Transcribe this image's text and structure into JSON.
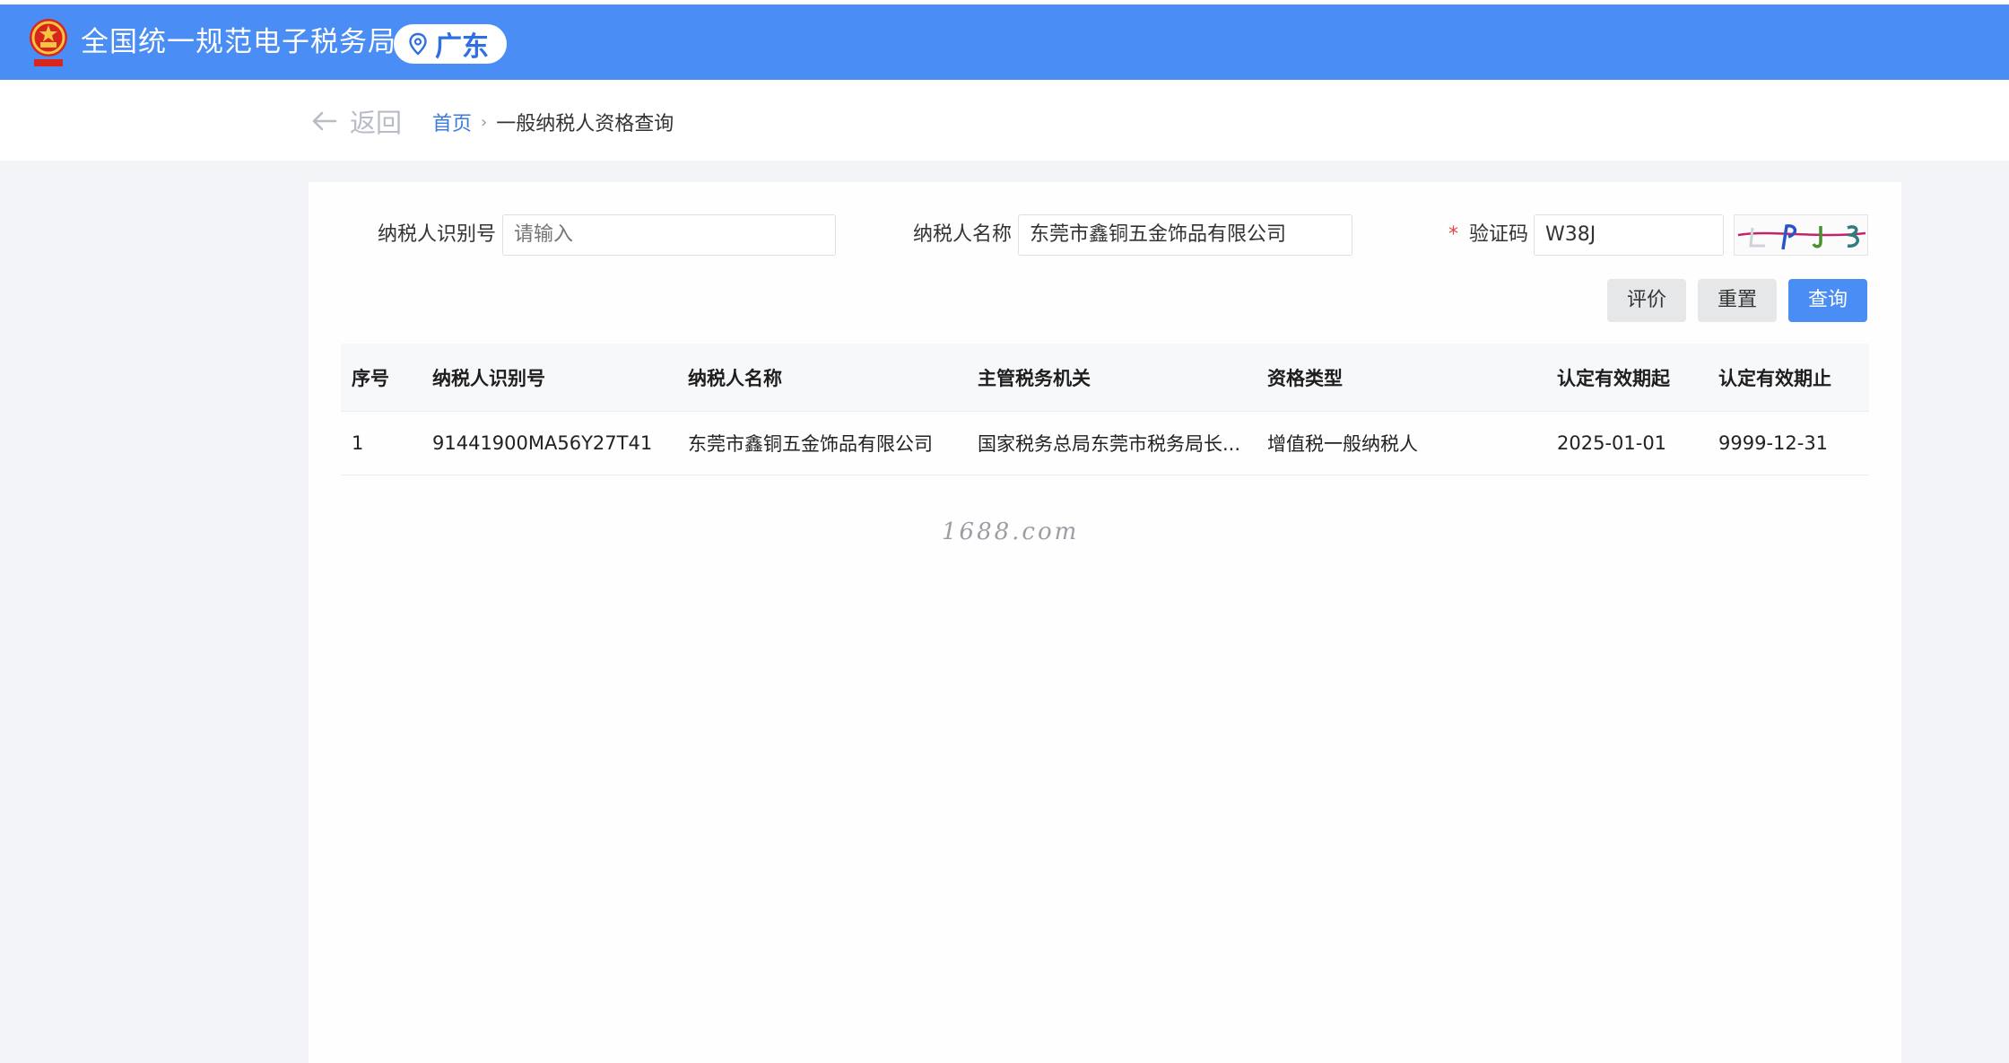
{
  "header": {
    "title": "全国统一规范电子税务局",
    "region": "广东",
    "emblem_icon": "national-emblem-icon",
    "brand_color": "#4a8ef5"
  },
  "nav": {
    "back_label": "返回",
    "breadcrumb": {
      "home": "首页",
      "separator": "›",
      "current": "一般纳税人资格查询"
    }
  },
  "form": {
    "taxpayer_id": {
      "label": "纳税人识别号",
      "value": "",
      "placeholder": "请输入"
    },
    "taxpayer_name": {
      "label": "纳税人名称",
      "value": "东莞市鑫铜五金饰品有限公司"
    },
    "captcha": {
      "required_mark": "*",
      "label": "验证码",
      "value": "W38J"
    }
  },
  "buttons": {
    "evaluate": "评价",
    "reset": "重置",
    "query": "查询"
  },
  "table": {
    "headers": [
      "序号",
      "纳税人识别号",
      "纳税人名称",
      "主管税务机关",
      "资格类型",
      "认定有效期起",
      "认定有效期止"
    ],
    "rows": [
      [
        "1",
        "91441900MA56Y27T41",
        "东莞市鑫铜五金饰品有限公司",
        "国家税务总局东莞市税务局长...",
        "增值税一般纳税人",
        "2025-01-01",
        "9999-12-31"
      ]
    ]
  },
  "watermark": "1688.com"
}
